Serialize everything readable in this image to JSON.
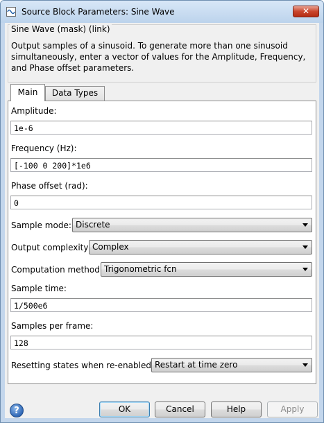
{
  "window": {
    "title": "Source Block Parameters: Sine Wave",
    "close_label": "✕"
  },
  "mask": {
    "title": "Sine Wave (mask) (link)",
    "description": "Output samples of a sinusoid.  To generate more than one sinusoid simultaneously, enter a vector of values for the Amplitude, Frequency, and Phase offset parameters."
  },
  "tabs": [
    {
      "label": "Main",
      "active": true
    },
    {
      "label": "Data Types",
      "active": false
    }
  ],
  "params": {
    "amplitude": {
      "label": "Amplitude:",
      "value": "1e-6"
    },
    "frequency": {
      "label": "Frequency (Hz):",
      "value": "[-100 0 200]*1e6"
    },
    "phase": {
      "label": "Phase offset (rad):",
      "value": "0"
    },
    "sample_mode": {
      "label": "Sample mode:",
      "value": "Discrete"
    },
    "output_complexity": {
      "label": "Output complexity:",
      "value": "Complex"
    },
    "computation_method": {
      "label": "Computation method:",
      "value": "Trigonometric fcn"
    },
    "sample_time": {
      "label": "Sample time:",
      "value": "1/500e6"
    },
    "samples_per_frame": {
      "label": "Samples per frame:",
      "value": "128"
    },
    "resetting_states": {
      "label": "Resetting states when re-enabled:",
      "value": "Restart at time zero"
    }
  },
  "buttons": {
    "help_icon": "?",
    "ok": "OK",
    "cancel": "Cancel",
    "help": "Help",
    "apply": "Apply"
  }
}
